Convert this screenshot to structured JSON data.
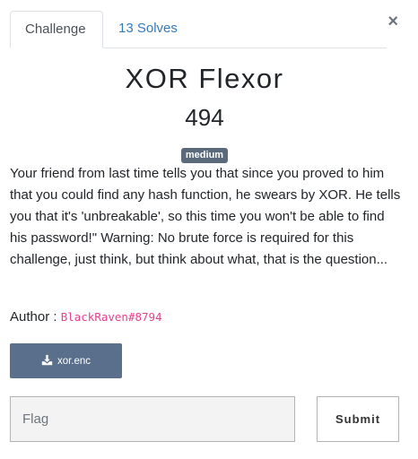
{
  "tabs": {
    "challenge": "Challenge",
    "solves": "13 Solves"
  },
  "close": "×",
  "challenge": {
    "name": "XOR Flexor",
    "value": "494",
    "difficulty": "medium",
    "description": "Your friend from last time tells you that since you proved to him that you could find any hash function, he swears by XOR. He tells you that it's 'unbreakable', so this time you won't be able to find his password!\" Warning: No brute force is required for this challenge, just think, but think about what, that is the question...",
    "author_label": "Author : ",
    "author": "BlackRaven#8794",
    "file": "xor.enc",
    "file_icon": "download-icon"
  },
  "form": {
    "flag_placeholder": "Flag",
    "submit_label": "Submit"
  },
  "colors": {
    "tab_link": "#337ab7",
    "badge": "#5b6a7a",
    "file_button": "#5a6f8c",
    "author_name": "#e83e8c"
  }
}
